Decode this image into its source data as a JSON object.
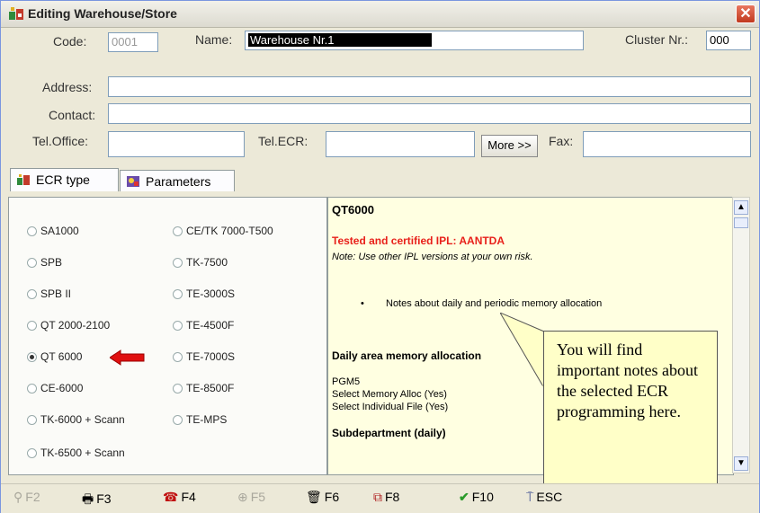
{
  "window": {
    "title": "Editing Warehouse/Store",
    "close": "✕"
  },
  "form": {
    "code_label": "Code:",
    "code_value": "0001",
    "name_label": "Name:",
    "name_value": "Warehouse Nr.1",
    "cluster_label": "Cluster Nr.:",
    "cluster_value": "000",
    "address_label": "Address:",
    "address_value": "",
    "contact_label": "Contact:",
    "contact_value": "",
    "tel_office_label": "Tel.Office:",
    "tel_office_value": "",
    "tel_ecr_label": "Tel.ECR:",
    "tel_ecr_value": "",
    "more_button": "More >>",
    "fax_label": "Fax:",
    "fax_value": ""
  },
  "tabs": [
    {
      "label": "ECR type",
      "icon": "ecr-icon",
      "active": true
    },
    {
      "label": "Parameters",
      "icon": "parameters-icon",
      "active": false
    }
  ],
  "ecr_types": [
    {
      "label": "SA1000",
      "selected": false
    },
    {
      "label": "SPB",
      "selected": false
    },
    {
      "label": "SPB II",
      "selected": false
    },
    {
      "label": "QT 2000-2100",
      "selected": false
    },
    {
      "label": "QT 6000",
      "selected": true
    },
    {
      "label": "CE-6000",
      "selected": false
    },
    {
      "label": "TK-6000 + Scann",
      "selected": false
    },
    {
      "label": "TK-6500 + Scann",
      "selected": false
    },
    {
      "label": "CE/TK 7000-T500",
      "selected": false
    },
    {
      "label": "TK-7500",
      "selected": false
    },
    {
      "label": "TE-3000S",
      "selected": false
    },
    {
      "label": "TE-4500F",
      "selected": false
    },
    {
      "label": "TE-7000S",
      "selected": false
    },
    {
      "label": "TE-8500F",
      "selected": false
    },
    {
      "label": "TE-MPS",
      "selected": false
    }
  ],
  "notes": {
    "heading": "QT6000",
    "certified": "Tested and certified IPL:  AANTDA",
    "note": "Note: Use other IPL versions at your own risk.",
    "bullet": "Notes about daily and periodic memory allocation",
    "daily_heading": "Daily area memory allocation",
    "line1": "PGM5",
    "line2": "Select Memory Alloc (Yes)",
    "line3": "Select Individual File (Yes)",
    "subdept": "Subdepartment (daily)"
  },
  "callout": "You will find important notes about the selected ECR programming here.",
  "toolbar": [
    {
      "label": "F2",
      "icon": "key-icon",
      "enabled": false
    },
    {
      "label": "F3",
      "icon": "printer-icon",
      "enabled": true
    },
    {
      "label": "F4",
      "icon": "phone-icon",
      "enabled": true
    },
    {
      "label": "F5",
      "icon": "zoom-icon",
      "enabled": false
    },
    {
      "label": "F6",
      "icon": "trash-icon",
      "enabled": true
    },
    {
      "label": "F8",
      "icon": "copy-icon",
      "enabled": true
    },
    {
      "label": "F10",
      "icon": "checkmark-icon",
      "enabled": true
    },
    {
      "label": "ESC",
      "icon": "exit-icon",
      "enabled": true
    }
  ],
  "colors": {
    "certified_red": "#e8201a",
    "callout_bg": "#ffffc8",
    "notes_bg": "#ffffe1",
    "arrow_red": "#e01010"
  }
}
